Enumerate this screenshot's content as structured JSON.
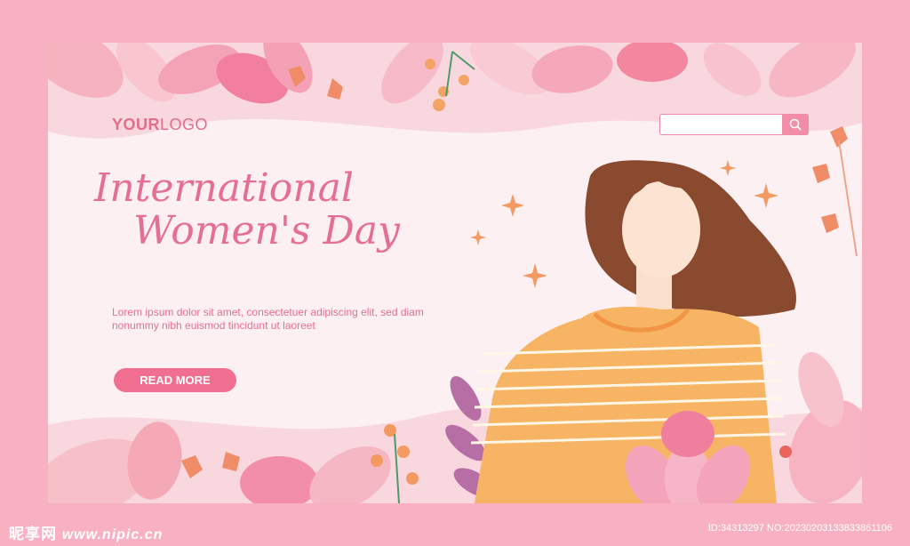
{
  "logo": {
    "bold": "YOUR",
    "regular": "LOGO"
  },
  "search": {
    "value": "",
    "icon": "search-icon"
  },
  "hero": {
    "title_line1": "International",
    "title_line2": "Women's Day",
    "description": "Lorem ipsum dolor sit amet, consectetuer adipiscing elit, sed diam nonummy nibh euismod tincidunt ut laoreet",
    "cta_label": "READ MORE"
  },
  "watermark": {
    "brand": "昵享网",
    "url": "www.nipic.cn",
    "id_text": "ID:34313297 NO:20230203133833861106"
  },
  "colors": {
    "frame": "#f8b1c3",
    "accent": "#f06f91",
    "text": "#e56f90",
    "background": "#fdf0f2"
  }
}
